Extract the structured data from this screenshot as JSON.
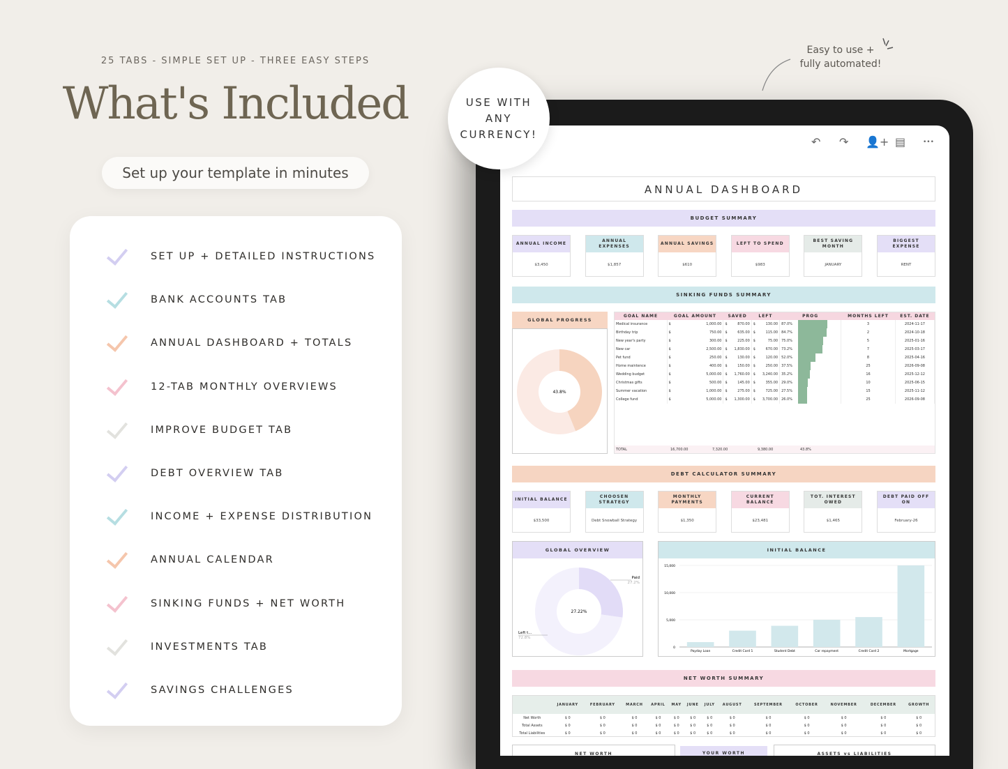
{
  "promo": {
    "tagline": "25 TABS - SIMPLE SET UP - THREE EASY STEPS",
    "headline": "What's Included",
    "subtitle": "Set up your template in minutes",
    "badge": [
      "USE WITH",
      "ANY",
      "CURRENCY!"
    ],
    "note": "Easy to use + fully automated!"
  },
  "features": [
    {
      "label": "SET UP + DETAILED INSTRUCTIONS",
      "color": "#c9c2ee"
    },
    {
      "label": "BANK ACCOUNTS TAB",
      "color": "#a5d7dc"
    },
    {
      "label": "ANNUAL DASHBOARD + TOTALS",
      "color": "#f3b898"
    },
    {
      "label": "12-TAB MONTHLY OVERVIEWS",
      "color": "#f2b3c3"
    },
    {
      "label": "IMPROVE BUDGET TAB",
      "color": "#dcdcd7"
    },
    {
      "label": "DEBT OVERVIEW TAB",
      "color": "#c9c2ee"
    },
    {
      "label": "INCOME + EXPENSE DISTRIBUTION",
      "color": "#a5d7dc"
    },
    {
      "label": "ANNUAL CALENDAR",
      "color": "#f3b898"
    },
    {
      "label": "SINKING FUNDS + NET WORTH",
      "color": "#f2b3c3"
    },
    {
      "label": "INVESTMENTS TAB",
      "color": "#dcdcd7"
    },
    {
      "label": "SAVINGS CHALLENGES",
      "color": "#c9c2ee"
    }
  ],
  "toolbar": [
    "undo-icon",
    "redo-icon",
    "add-person-icon",
    "comment-icon",
    "more-icon"
  ],
  "dashboard": {
    "title": "ANNUAL DASHBOARD",
    "budget_summary": "BUDGET SUMMARY",
    "budget_cards": [
      {
        "label": "ANNUAL INCOME",
        "value": "$3,450",
        "color": "#e4dff7"
      },
      {
        "label": "ANNUAL EXPENSES",
        "value": "$1,857",
        "color": "#cfe8ec"
      },
      {
        "label": "ANNUAL SAVINGS",
        "value": "$610",
        "color": "#f7d6c3"
      },
      {
        "label": "LEFT TO SPEND",
        "value": "$983",
        "color": "#f7d9e2"
      },
      {
        "label": "BEST SAVING MONTH",
        "value": "JANUARY",
        "color": "#e5ebe8"
      },
      {
        "label": "BIGGEST EXPENSE",
        "value": "RENT",
        "color": "#e4dff7"
      }
    ],
    "sinking_summary": "SINKING FUNDS SUMMARY",
    "global_progress": {
      "label": "GLOBAL PROGRESS",
      "value": "43.8%",
      "fraction": 0.438
    },
    "sinking_headers": [
      "GOAL NAME",
      "GOAL AMOUNT",
      "SAVED",
      "LEFT",
      "PROG",
      "MONTHS LEFT",
      "EST. DATE"
    ],
    "sinking_rows": [
      [
        "Medical insurance",
        "1,000.00",
        "870.00",
        "130.00",
        "87.0%",
        3,
        "2024-11-17"
      ],
      [
        "Birthday trip",
        "750.00",
        "635.00",
        "115.00",
        "84.7%",
        2,
        "2024-10-18"
      ],
      [
        "New year's party",
        "300.00",
        "225.00",
        "75.00",
        "75.0%",
        5,
        "2025-01-16"
      ],
      [
        "New car",
        "2,500.00",
        "1,830.00",
        "670.00",
        "73.2%",
        7,
        "2025-03-17"
      ],
      [
        "Pet fund",
        "250.00",
        "130.00",
        "120.00",
        "52.0%",
        8,
        "2025-04-16"
      ],
      [
        "Home maintence",
        "400.00",
        "150.00",
        "250.00",
        "37.5%",
        25,
        "2026-09-08"
      ],
      [
        "Wedding budget",
        "5,000.00",
        "1,760.00",
        "3,240.00",
        "35.2%",
        16,
        "2025-12-12"
      ],
      [
        "Christmas gifts",
        "500.00",
        "145.00",
        "355.00",
        "29.0%",
        10,
        "2025-06-15"
      ],
      [
        "Summer vacation",
        "1,000.00",
        "275.00",
        "725.00",
        "27.5%",
        15,
        "2025-11-12"
      ],
      [
        "College fund",
        "5,000.00",
        "1,300.00",
        "3,700.00",
        "26.0%",
        25,
        "2026-09-08"
      ]
    ],
    "sinking_total": [
      "TOTAL",
      "16,700.00",
      "7,320.00",
      "9,380.00",
      "43.8%"
    ],
    "debt_summary": "DEBT CALCULATOR SUMMARY",
    "debt_cards": [
      {
        "label": "INITIAL BALANCE",
        "value": "$33,500",
        "color": "#e4dff7"
      },
      {
        "label": "CHOOSEN STRATEGY",
        "value": "Debt Snowball Strategy",
        "color": "#cfe8ec"
      },
      {
        "label": "MONTHLY PAYMENTS",
        "value": "$1,350",
        "color": "#f7d6c3"
      },
      {
        "label": "CURRENT BALANCE",
        "value": "$23,481",
        "color": "#f7d9e2"
      },
      {
        "label": "TOT. INTEREST OWED",
        "value": "$1,465",
        "color": "#e5ebe8"
      },
      {
        "label": "DEBT PAID OFF ON",
        "value": "February-26",
        "color": "#e4dff7"
      }
    ],
    "net_worth_summary": "NET WORTH SUMMARY",
    "nw_headers": [
      "",
      "JANUARY",
      "FEBRUARY",
      "MARCH",
      "APRIL",
      "MAY",
      "JUNE",
      "JULY",
      "AUGUST",
      "SEPTEMBER",
      "OCTOBER",
      "NOVEMBER",
      "DECEMBER",
      "GROWTH"
    ],
    "nw_rows": [
      "Net Worth",
      "Total Assets",
      "Total Liabilities"
    ],
    "nw_cell": "$ 0",
    "bottom_boxes": [
      "NET WORTH",
      "YOUR WORTH",
      "ASSETS vs LIABILITIES"
    ]
  },
  "chart_data": [
    {
      "type": "pie",
      "title": "GLOBAL PROGRESS",
      "center_label": "43.8%",
      "values": [
        43.8,
        56.2
      ],
      "colors": [
        "#f6d4bf",
        "#fbeae4"
      ]
    },
    {
      "type": "pie",
      "title": "GLOBAL OVERVIEW",
      "center_label": "27.22%",
      "categories": [
        "Paid",
        "Left t..."
      ],
      "values": [
        27.2,
        72.8
      ],
      "labels": [
        "27.2%",
        "72.8%"
      ],
      "colors": [
        "#e2dcf7",
        "#f3f1fc"
      ]
    },
    {
      "type": "bar",
      "title": "INITIAL BALANCE",
      "categories": [
        "Payday Loan",
        "Credit Card 1",
        "Student Debt",
        "Car repayment",
        "Credit Card 2",
        "Mortgage"
      ],
      "values": [
        900,
        3000,
        3900,
        5000,
        5500,
        15000
      ],
      "yticks": [
        "0",
        "5,000",
        "10,000",
        "15,000"
      ],
      "ylim": [
        0,
        15000
      ],
      "grid": true,
      "color": "#d2e8ec"
    }
  ]
}
